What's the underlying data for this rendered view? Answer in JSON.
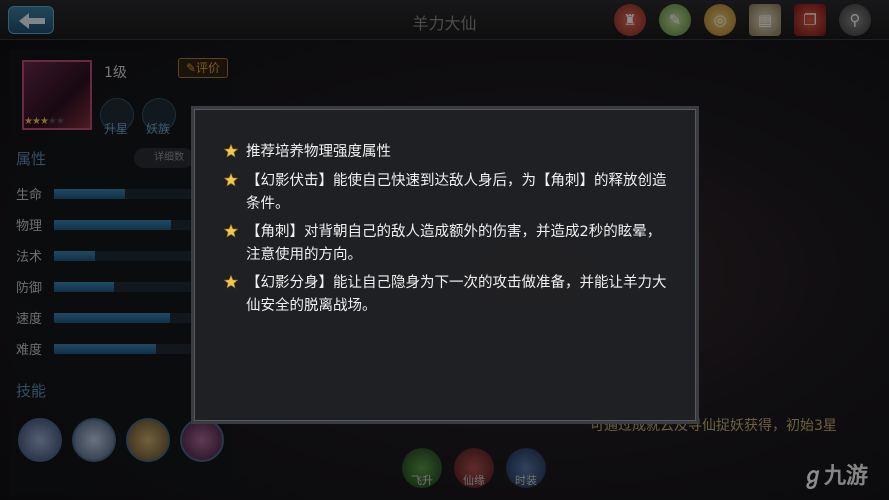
{
  "header": {
    "title": "羊力大仙"
  },
  "top_icons": [
    "chess-icon",
    "scroll-icon",
    "coin-icon",
    "map-icon",
    "book-icon",
    "magnifier-icon"
  ],
  "hero": {
    "level": "1级",
    "rate_label": "评价",
    "stars": 3,
    "max_stars": 5
  },
  "badges": [
    {
      "label": "升星"
    },
    {
      "label": "妖族"
    }
  ],
  "attributes": {
    "title": "属性",
    "detail_label": "详细数",
    "items": [
      {
        "label": "生命",
        "value": 0.47
      },
      {
        "label": "物理",
        "value": 0.78
      },
      {
        "label": "法术",
        "value": 0.27
      },
      {
        "label": "防御",
        "value": 0.4
      },
      {
        "label": "速度",
        "value": 0.77
      },
      {
        "label": "难度",
        "value": 0.68
      }
    ]
  },
  "skills": {
    "title": "技能"
  },
  "bottom": {
    "note": "可通过成就云及寻仙捉妖获得，初始3星",
    "tabs": [
      {
        "label": "飞升"
      },
      {
        "label": "仙缘"
      },
      {
        "label": "时装"
      }
    ],
    "watermark": "九游"
  },
  "dialog": {
    "tips": [
      {
        "text": "推荐培养物理强度属性"
      },
      {
        "text": "【幻影伏击】能使自己快速到达敌人身后，为【角刺】的释放创造条件。"
      },
      {
        "text": "【角刺】对背朝自己的敌人造成额外的伤害，并造成2秒的眩晕，注意使用的方向。"
      },
      {
        "text": "【幻影分身】能让自己隐身为下一次的攻击做准备，并能让羊力大仙安全的脱离战场。"
      }
    ]
  }
}
